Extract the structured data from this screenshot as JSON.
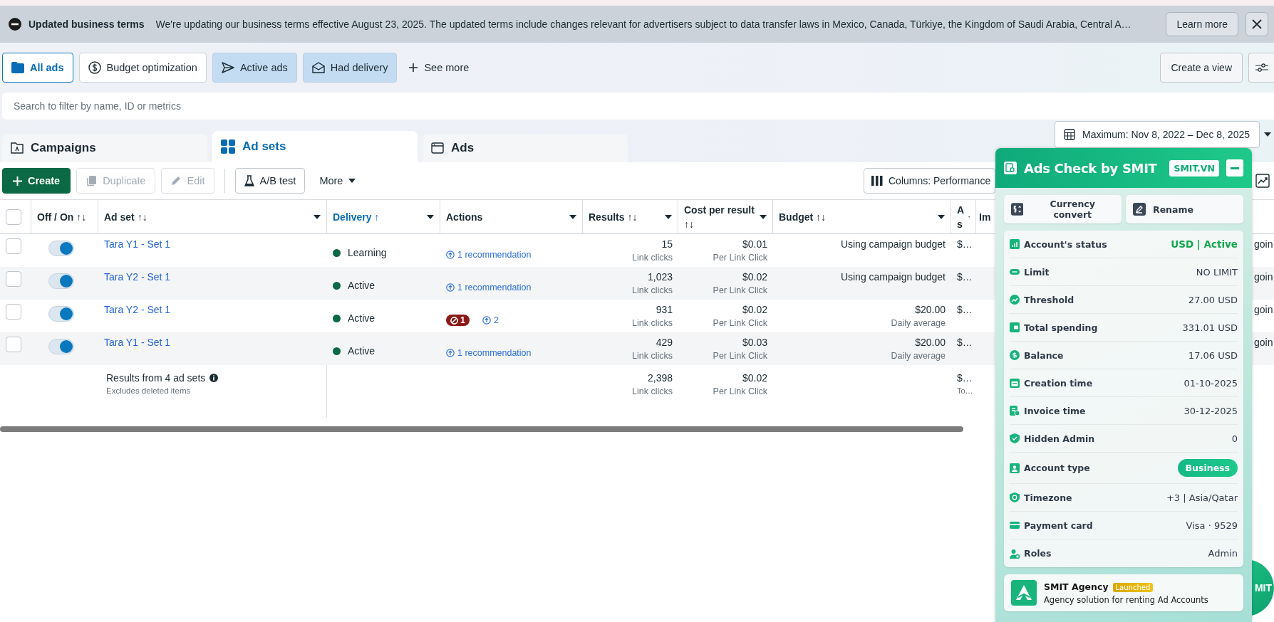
{
  "banner": {
    "title": "Updated business terms",
    "message": "We're updating our business terms effective August 23, 2025. The updated terms include changes relevant for advertisers subject to data transfer laws in Mexico, Canada, Türkiye, the Kingdom of Saudi Arabia, Central A…",
    "action": "Learn more"
  },
  "filters": [
    {
      "label": "All ads",
      "selected": true,
      "highlighted": false
    },
    {
      "label": "Budget optimization",
      "selected": false,
      "highlighted": false
    },
    {
      "label": "Active ads",
      "selected": false,
      "highlighted": true
    },
    {
      "label": "Had delivery",
      "selected": false,
      "highlighted": true
    }
  ],
  "see_more": "See more",
  "create_view": "Create a view",
  "search": {
    "placeholder": "Search to filter by name, ID or metrics"
  },
  "levels": [
    {
      "label": "Campaigns",
      "selected": false
    },
    {
      "label": "Ad sets",
      "selected": true
    },
    {
      "label": "Ads",
      "selected": false
    }
  ],
  "date_range": "Maximum: Nov 8, 2022 – Dec 8, 2025",
  "toolbar": {
    "buttons": [
      {
        "label": "Create",
        "kind": "primary",
        "disabled": false
      },
      {
        "label": "Duplicate",
        "kind": "duplicate",
        "disabled": true
      },
      {
        "label": "Edit",
        "kind": "edit",
        "disabled": true
      },
      {
        "label": "A/B test",
        "kind": "abtest",
        "disabled": false
      }
    ],
    "more": "More",
    "columns": "Columns: Performance"
  },
  "table": {
    "columns": [
      {
        "label": "Off / On ↑↓",
        "sorted": false,
        "menu": false
      },
      {
        "label": "Ad set ↑↓",
        "sorted": false,
        "menu": true
      },
      {
        "label": "Delivery ↑",
        "sorted": true,
        "menu": true
      },
      {
        "label": "Actions",
        "sorted": false,
        "menu": true
      },
      {
        "label": "Results ↑↓",
        "sorted": false,
        "menu": true
      },
      {
        "label": "Cost per result ↑↓",
        "sorted": false,
        "menu": true
      },
      {
        "label": "Budget ↑↓",
        "sorted": false,
        "menu": true
      },
      {
        "label": "A s",
        "sorted": false,
        "menu": true
      },
      {
        "label": "Im",
        "sorted": false,
        "menu": false
      }
    ],
    "all_selected": false,
    "rows": [
      {
        "selected": false,
        "on": true,
        "name": "Tara Y1 - Set 1",
        "delivery": "Learning",
        "actions": [
          {
            "kind": "recommendation",
            "text": "1 recommendation"
          }
        ],
        "results": "15",
        "results_sub": "Link clicks",
        "cost": "$0.01",
        "cost_sub": "Per Link Click",
        "budget": "Using campaign budget",
        "column_8": "$…",
        "column_last": "goin"
      },
      {
        "selected": false,
        "on": true,
        "name": "Tara Y2 - Set 1",
        "delivery": "Active",
        "actions": [
          {
            "kind": "recommendation",
            "text": "1 recommendation"
          }
        ],
        "results": "1,023",
        "results_sub": "Link clicks",
        "cost": "$0.02",
        "cost_sub": "Per Link Click",
        "budget": "Using campaign budget",
        "column_8": "$…",
        "column_last": "goin"
      },
      {
        "selected": false,
        "on": true,
        "name": "Tara Y2 - Set 1",
        "delivery": "Active",
        "actions": [
          {
            "kind": "issue",
            "text": "1"
          },
          {
            "kind": "recommendation",
            "text": "2"
          }
        ],
        "results": "931",
        "results_sub": "Link clicks",
        "cost": "$0.02",
        "cost_sub": "Per Link Click",
        "budget": "$20.00",
        "budget_sub": "Daily average",
        "column_8": "$…",
        "column_last": "goin"
      },
      {
        "selected": false,
        "on": true,
        "name": "Tara Y1 - Set 1",
        "delivery": "Active",
        "actions": [
          {
            "kind": "recommendation",
            "text": "1 recommendation"
          }
        ],
        "results": "429",
        "results_sub": "Link clicks",
        "cost": "$0.03",
        "cost_sub": "Per Link Click",
        "budget": "$20.00",
        "budget_sub": "Daily average",
        "column_8": "$…",
        "column_last": "goin"
      }
    ],
    "summary": {
      "label": "Results from 4 ad sets",
      "sub": "Excludes deleted items",
      "results": "2,398",
      "results_sub": "Link clicks",
      "cost": "$0.02",
      "cost_sub": "Per Link Click",
      "column_8": "$…",
      "column_8_sub": "To…"
    }
  },
  "smit": {
    "title": "Ads Check by SMIT",
    "badge": "SMIT.VN",
    "buttons": [
      "Currency convert",
      "Rename"
    ],
    "rows": [
      {
        "label": "Account's status",
        "value": "USD | Active",
        "kind": "status"
      },
      {
        "label": "Limit",
        "value": "NO LIMIT",
        "kind": "text"
      },
      {
        "label": "Threshold",
        "value": "27.00 USD",
        "kind": "text"
      },
      {
        "label": "Total spending",
        "value": "331.01 USD",
        "kind": "text"
      },
      {
        "label": "Balance",
        "value": "17.06 USD",
        "kind": "text"
      },
      {
        "label": "Creation time",
        "value": "01-10-2025",
        "kind": "text"
      },
      {
        "label": "Invoice time",
        "value": "30-12-2025",
        "kind": "text"
      },
      {
        "label": "Hidden Admin",
        "value": "0",
        "kind": "text"
      },
      {
        "label": "Account type",
        "value": "Business",
        "kind": "pill"
      },
      {
        "label": "Timezone",
        "value": "+3 | Asia/Qatar",
        "kind": "text"
      },
      {
        "label": "Payment card",
        "value": "Visa · 9529",
        "kind": "text"
      },
      {
        "label": "Roles",
        "value": "Admin",
        "kind": "text"
      }
    ],
    "agency": {
      "name": "SMIT Agency",
      "badge": "Launched",
      "description": "Agency solution for renting Ad Accounts"
    },
    "fab": "MIT"
  }
}
